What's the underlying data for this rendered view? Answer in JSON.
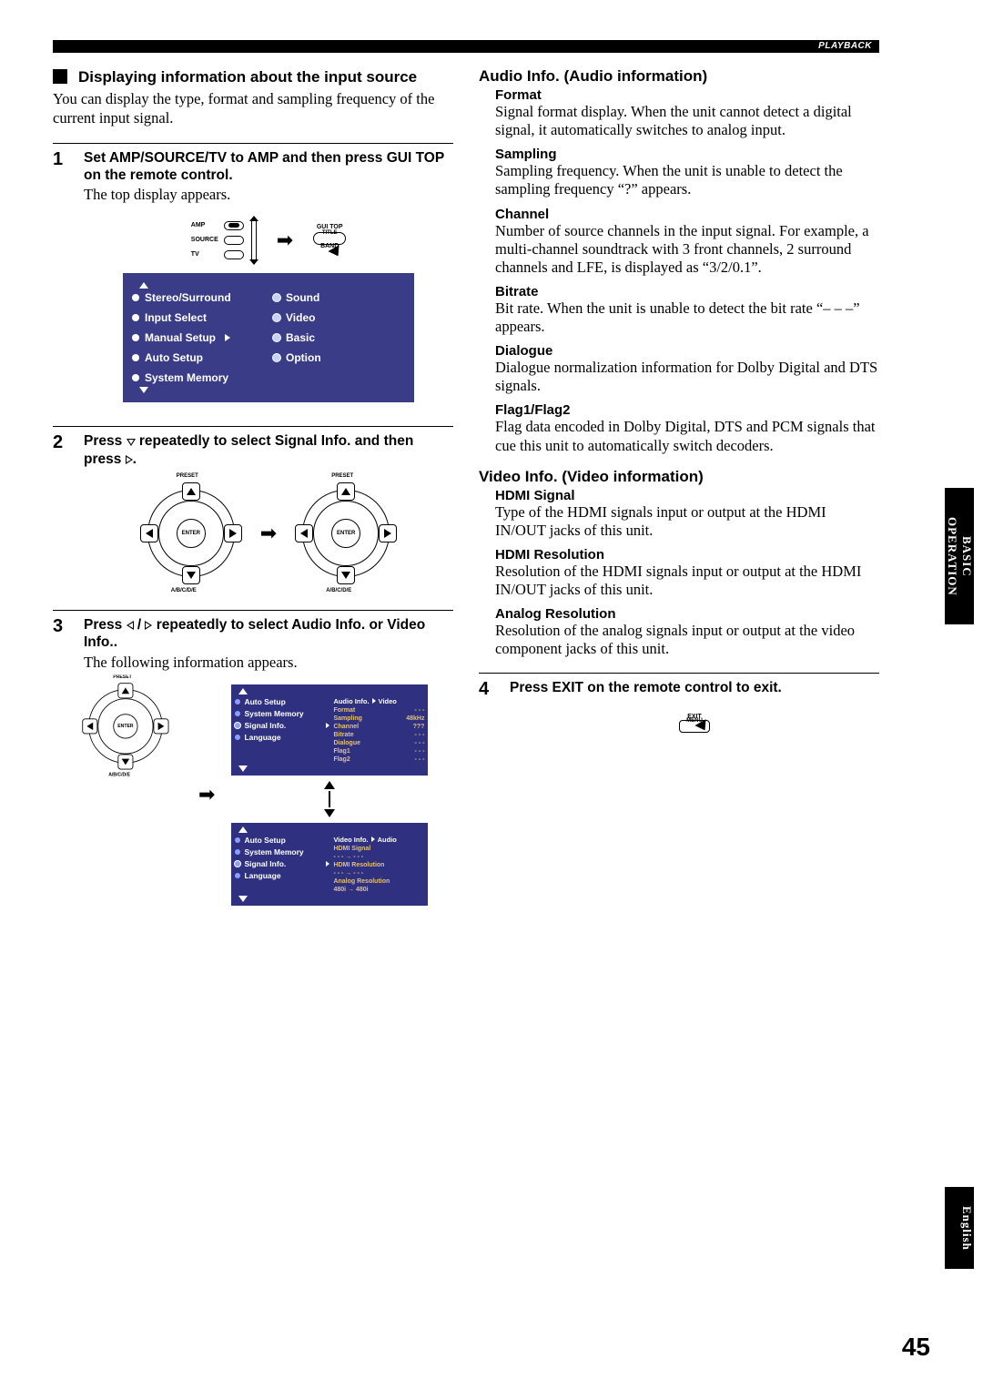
{
  "header_label": "PLAYBACK",
  "page_number": "45",
  "side_tab_operation": "BASIC OPERATION",
  "side_tab_language": "English",
  "left": {
    "section_title": "Displaying information about the input source",
    "intro": "You can display the type, format and sampling frequency of the current input signal.",
    "step1": {
      "num": "1",
      "title": "Set AMP/SOURCE/TV to AMP and then press GUI TOP on the remote control.",
      "sub": "The top display appears.",
      "switch_labels": {
        "amp": "AMP",
        "source": "SOURCE",
        "tv": "TV"
      },
      "title_btn": {
        "top": "GUI TOP",
        "name": "TITLE",
        "bottom": "BAND"
      }
    },
    "menu1": {
      "col1": [
        "Stereo/Surround",
        "Input Select",
        "Manual Setup",
        "Auto Setup",
        "System Memory"
      ],
      "col2": [
        "Sound",
        "Video",
        "Basic",
        "Option"
      ],
      "selected_index": 2
    },
    "step2": {
      "num": "2",
      "title_pre": "Press ",
      "title_mid": " repeatedly to select Signal Info. and then press ",
      "title_post": ".",
      "nav": {
        "preset": "PRESET",
        "abcde": "A/B/C/D/E",
        "enter": "ENTER"
      }
    },
    "step3": {
      "num": "3",
      "title_pre": "Press ",
      "title_mid": " / ",
      "title_post": " repeatedly to select Audio Info. or Video Info..",
      "sub": "The following information appears.",
      "menu_left": [
        "Auto Setup",
        "System Memory",
        "Signal Info.",
        "Language"
      ],
      "menu_left_sel": 2,
      "audio_panel": {
        "header": "Audio Info.",
        "header_link": "Video",
        "rows": [
          {
            "k": "Format",
            "v": "- - -"
          },
          {
            "k": "Sampling",
            "v": "48kHz"
          },
          {
            "k": "Channel",
            "v": "???"
          },
          {
            "k": "Bitrate",
            "v": "- - -"
          },
          {
            "k": "Dialogue",
            "v": "- - -"
          },
          {
            "k": "Flag1",
            "v": "- - -"
          },
          {
            "k": "Flag2",
            "v": "- - -"
          }
        ]
      },
      "video_panel": {
        "header": "Video Info.",
        "header_link": "Audio",
        "rows": [
          {
            "k": "HDMI Signal",
            "v": ""
          },
          {
            "k": "- - -   →   - - -",
            "v": ""
          },
          {
            "k": "HDMI Resolution",
            "v": ""
          },
          {
            "k": "- - -   →   - - -",
            "v": ""
          },
          {
            "k": "Analog Resolution",
            "v": ""
          },
          {
            "k": "480i   →   480i",
            "v": ""
          }
        ]
      }
    }
  },
  "right": {
    "audio_title": "Audio Info. (Audio information)",
    "audio": [
      {
        "h": "Format",
        "p": "Signal format display. When the unit cannot detect a digital signal, it automatically switches to analog input."
      },
      {
        "h": "Sampling",
        "p": "Sampling frequency. When the unit is unable to detect the sampling frequency “?” appears."
      },
      {
        "h": "Channel",
        "p": "Number of source channels in the input signal. For example, a multi-channel soundtrack with 3 front channels, 2 surround channels and LFE, is displayed as “3/2/0.1”."
      },
      {
        "h": "Bitrate",
        "p": "Bit rate. When the unit is unable to detect the bit rate “– – –” appears."
      },
      {
        "h": "Dialogue",
        "p": "Dialogue normalization information for Dolby Digital and DTS signals."
      },
      {
        "h": "Flag1/Flag2",
        "p": "Flag data encoded in Dolby Digital, DTS and PCM signals that cue this unit to automatically switch decoders."
      }
    ],
    "video_title": "Video Info. (Video information)",
    "video": [
      {
        "h": "HDMI Signal",
        "p": "Type of the HDMI signals input or output at the HDMI IN/OUT jacks of this unit."
      },
      {
        "h": "HDMI Resolution",
        "p": "Resolution of the HDMI signals input or output at the HDMI IN/OUT jacks of this unit."
      },
      {
        "h": "Analog Resolution",
        "p": "Resolution of the analog signals input or output at the video component jacks of this unit."
      }
    ],
    "step4": {
      "num": "4",
      "title": "Press EXIT on the remote control to exit.",
      "exit": {
        "top": "EXIT",
        "bottom": "MENU"
      }
    }
  }
}
